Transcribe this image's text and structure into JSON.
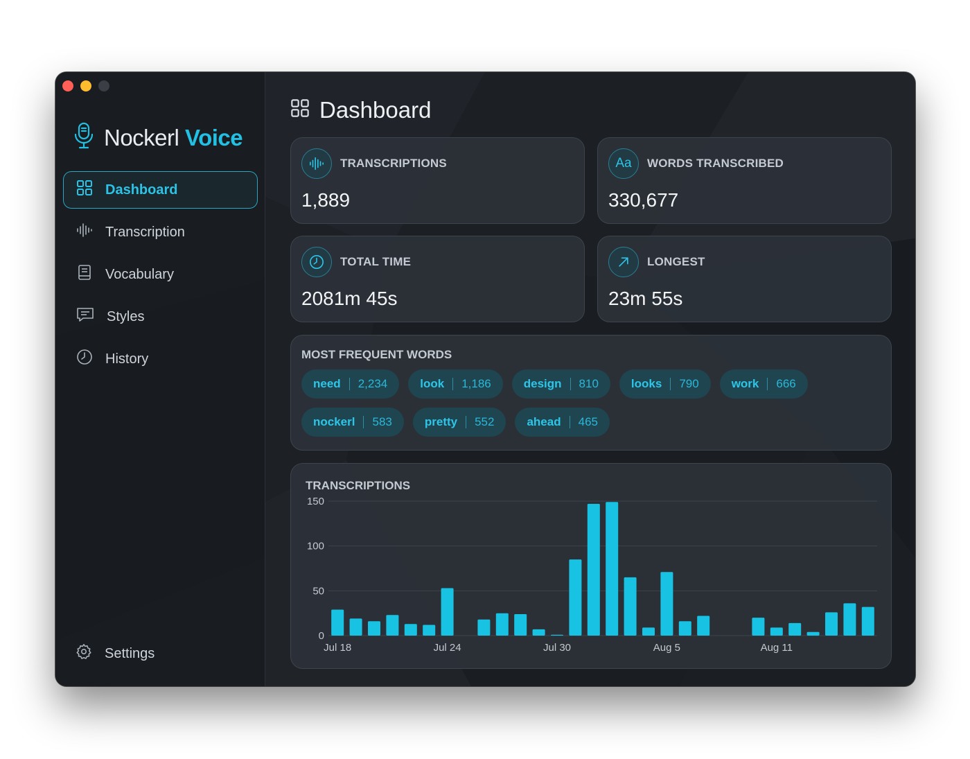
{
  "app": {
    "brand_name": "Nockerl",
    "brand_accent": "Voice",
    "accent_color": "#22c0e3"
  },
  "window_controls": [
    "close",
    "minimize",
    "zoom"
  ],
  "sidebar": {
    "items": [
      {
        "label": "Dashboard",
        "icon": "grid-icon",
        "active": true
      },
      {
        "label": "Transcription",
        "icon": "waveform-icon",
        "active": false
      },
      {
        "label": "Vocabulary",
        "icon": "book-icon",
        "active": false
      },
      {
        "label": "Styles",
        "icon": "chat-bubble-icon",
        "active": false
      },
      {
        "label": "History",
        "icon": "clock-icon",
        "active": false
      }
    ],
    "settings_label": "Settings"
  },
  "page": {
    "title": "Dashboard"
  },
  "stats": {
    "transcriptions": {
      "label": "TRANSCRIPTIONS",
      "value": "1,889",
      "icon": "waveform-icon"
    },
    "words": {
      "label": "WORDS TRANSCRIBED",
      "value": "330,677",
      "icon": "text-aa-icon",
      "icon_text": "Aa"
    },
    "total_time": {
      "label": "TOTAL TIME",
      "value": "2081m 45s",
      "icon": "clock-icon"
    },
    "longest": {
      "label": "LONGEST",
      "value": "23m 55s",
      "icon": "arrow-up-right-icon"
    }
  },
  "frequent_words": {
    "title": "MOST FREQUENT WORDS",
    "items": [
      {
        "word": "need",
        "count": "2,234"
      },
      {
        "word": "look",
        "count": "1,186"
      },
      {
        "word": "design",
        "count": "810"
      },
      {
        "word": "looks",
        "count": "790"
      },
      {
        "word": "work",
        "count": "666"
      },
      {
        "word": "nockerl",
        "count": "583"
      },
      {
        "word": "pretty",
        "count": "552"
      },
      {
        "word": "ahead",
        "count": "465"
      }
    ]
  },
  "chart_data": {
    "type": "bar",
    "title": "TRANSCRIPTIONS",
    "xlabel": "",
    "ylabel": "",
    "ylim": [
      0,
      150
    ],
    "yticks": [
      0,
      50,
      100,
      150
    ],
    "xtick_labels": [
      "Jul 18",
      "Jul 24",
      "Jul 30",
      "Aug 5",
      "Aug 11"
    ],
    "grid": true,
    "bar_color": "#18c2e3",
    "x": [
      "Jul 18",
      "Jul 19",
      "Jul 20",
      "Jul 21",
      "Jul 22",
      "Jul 23",
      "Jul 24",
      "Jul 25",
      "Jul 26",
      "Jul 27",
      "Jul 28",
      "Jul 29",
      "Jul 30",
      "Jul 31",
      "Aug 1",
      "Aug 2",
      "Aug 3",
      "Aug 4",
      "Aug 5",
      "Aug 6",
      "Aug 7",
      "Aug 8",
      "Aug 9",
      "Aug 10",
      "Aug 11",
      "Aug 12",
      "Aug 13",
      "Aug 14",
      "Aug 15"
    ],
    "values": [
      29,
      19,
      16,
      23,
      13,
      12,
      53,
      0,
      18,
      25,
      24,
      7,
      1,
      85,
      147,
      149,
      65,
      9,
      71,
      16,
      22,
      0,
      0,
      20,
      9,
      14,
      4,
      26,
      36,
      32
    ]
  }
}
